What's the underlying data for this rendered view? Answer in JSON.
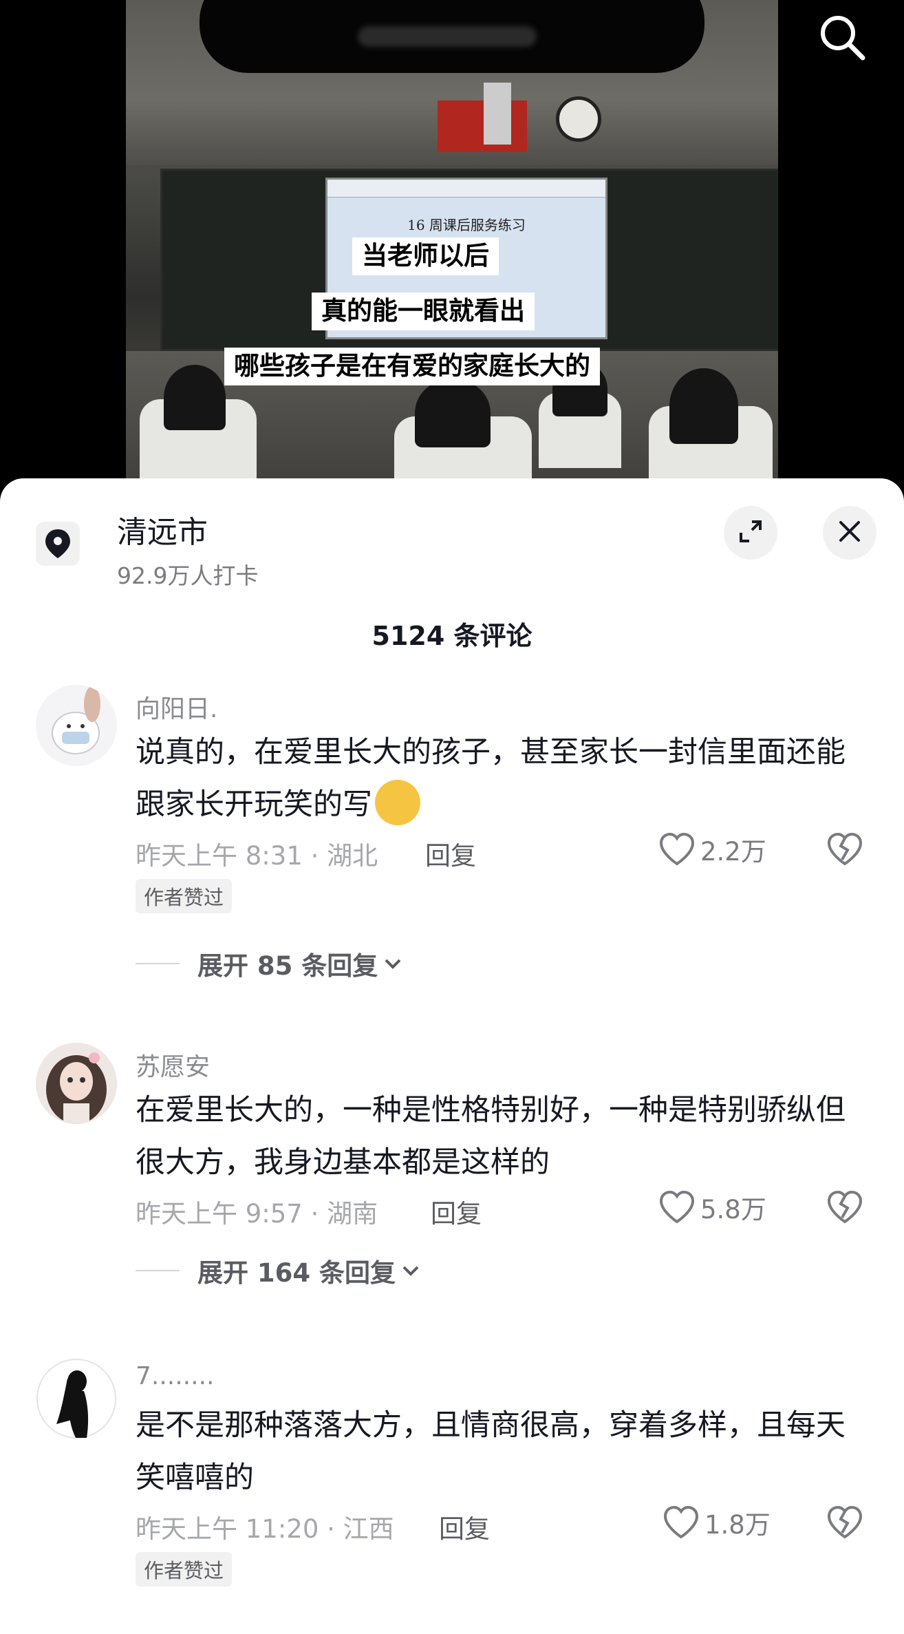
{
  "video": {
    "screen_title": "16 周课后服务练习",
    "captions": [
      "当老师以后",
      "真的能一眼就看出",
      "哪些孩子是在有爱的家庭长大的"
    ]
  },
  "location": {
    "title": "清远市",
    "subtitle": "92.9万人打卡"
  },
  "comments_count": "5124 条评论",
  "comments": [
    {
      "name": "向阳日.",
      "text": "说真的，在爱里长大的孩子，甚至家长一封信里面还能跟家长开玩笑的写",
      "meta": "昨天上午 8:31 · 湖北",
      "reply": "回复",
      "likes": "2.2万",
      "badge": "作者赞过",
      "expand": "展开 85 条回复"
    },
    {
      "name": "苏愿安",
      "text": "在爱里长大的，一种是性格特别好，一种是特别骄纵但很大方，我身边基本都是这样的",
      "meta": "昨天上午 9:57 · 湖南",
      "reply": "回复",
      "likes": "5.8万",
      "expand": "展开 164 条回复"
    },
    {
      "name": "7........",
      "text": "是不是那种落落大方，且情商很高，穿着多样，且每天笑嘻嘻的",
      "meta": "昨天上午 11:20 · 江西",
      "reply": "回复",
      "likes": "1.8万",
      "badge": "作者赞过"
    }
  ],
  "icons": {
    "search": "search-icon",
    "location": "location-pin-icon",
    "expand": "expand-icon",
    "close": "close-icon",
    "like": "heart-icon",
    "dislike": "broken-heart-icon",
    "chevron": "chevron-down-icon"
  }
}
